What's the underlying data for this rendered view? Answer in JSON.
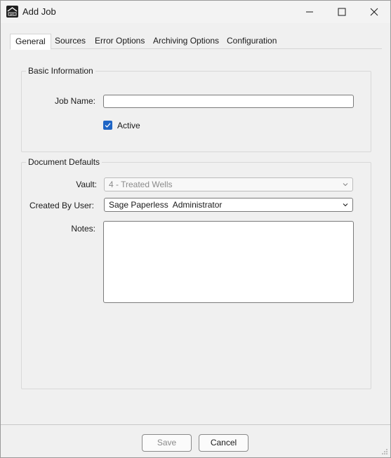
{
  "window": {
    "title": "Add Job",
    "app_icon": "app-logo-icon"
  },
  "tabs": [
    {
      "label": "General",
      "active": true
    },
    {
      "label": "Sources",
      "active": false
    },
    {
      "label": "Error Options",
      "active": false
    },
    {
      "label": "Archiving Options",
      "active": false
    },
    {
      "label": "Configuration",
      "active": false
    }
  ],
  "basic_info": {
    "group_label": "Basic Information",
    "job_name_label": "Job Name:",
    "job_name_value": "",
    "active_label": "Active",
    "active_checked": true
  },
  "document_defaults": {
    "group_label": "Document Defaults",
    "vault_label": "Vault:",
    "vault_value": "4 - Treated Wells",
    "created_by_label": "Created By User:",
    "created_by_value": "Sage Paperless  Administrator",
    "notes_label": "Notes:",
    "notes_value": ""
  },
  "footer": {
    "save_label": "Save",
    "cancel_label": "Cancel"
  },
  "colors": {
    "accent": "#1f65c5",
    "background": "#f0f0f0"
  }
}
